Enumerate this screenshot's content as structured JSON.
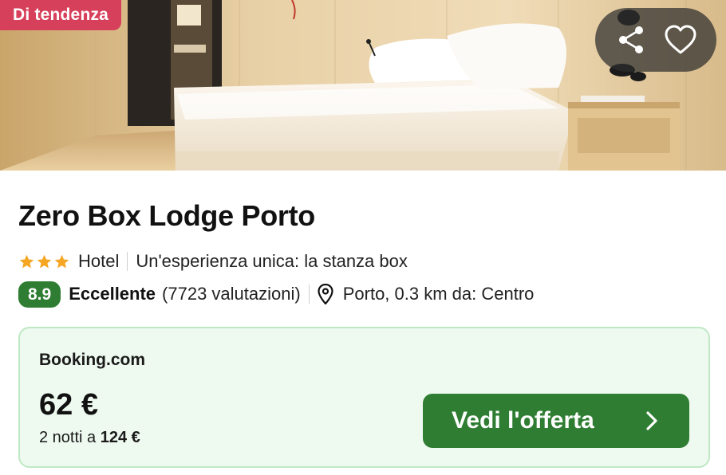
{
  "badge": {
    "label": "Di tendenza",
    "color": "#d6405a"
  },
  "actions": {
    "share_icon": "share-icon",
    "favorite_icon": "heart-icon"
  },
  "hotel": {
    "name": "Zero Box Lodge Porto",
    "stars": 3,
    "type": "Hotel",
    "tagline": "Un'esperienza unica: la stanza box"
  },
  "rating": {
    "score": "8.9",
    "label": "Eccellente",
    "count": "(7723 valutazioni)",
    "location": "Porto, 0.3 km da: Centro",
    "score_color": "#2e7d32"
  },
  "deal": {
    "provider": "Booking.com",
    "price": "62 €",
    "nights_prefix": "2 notti a",
    "nights_total": "124 €",
    "cta_label": "Vedi l'offerta",
    "accent": "#2e7d32"
  },
  "colors": {
    "star": "#f5a623",
    "deal_bg": "#eefaf0",
    "deal_border": "#bfe8c4"
  }
}
